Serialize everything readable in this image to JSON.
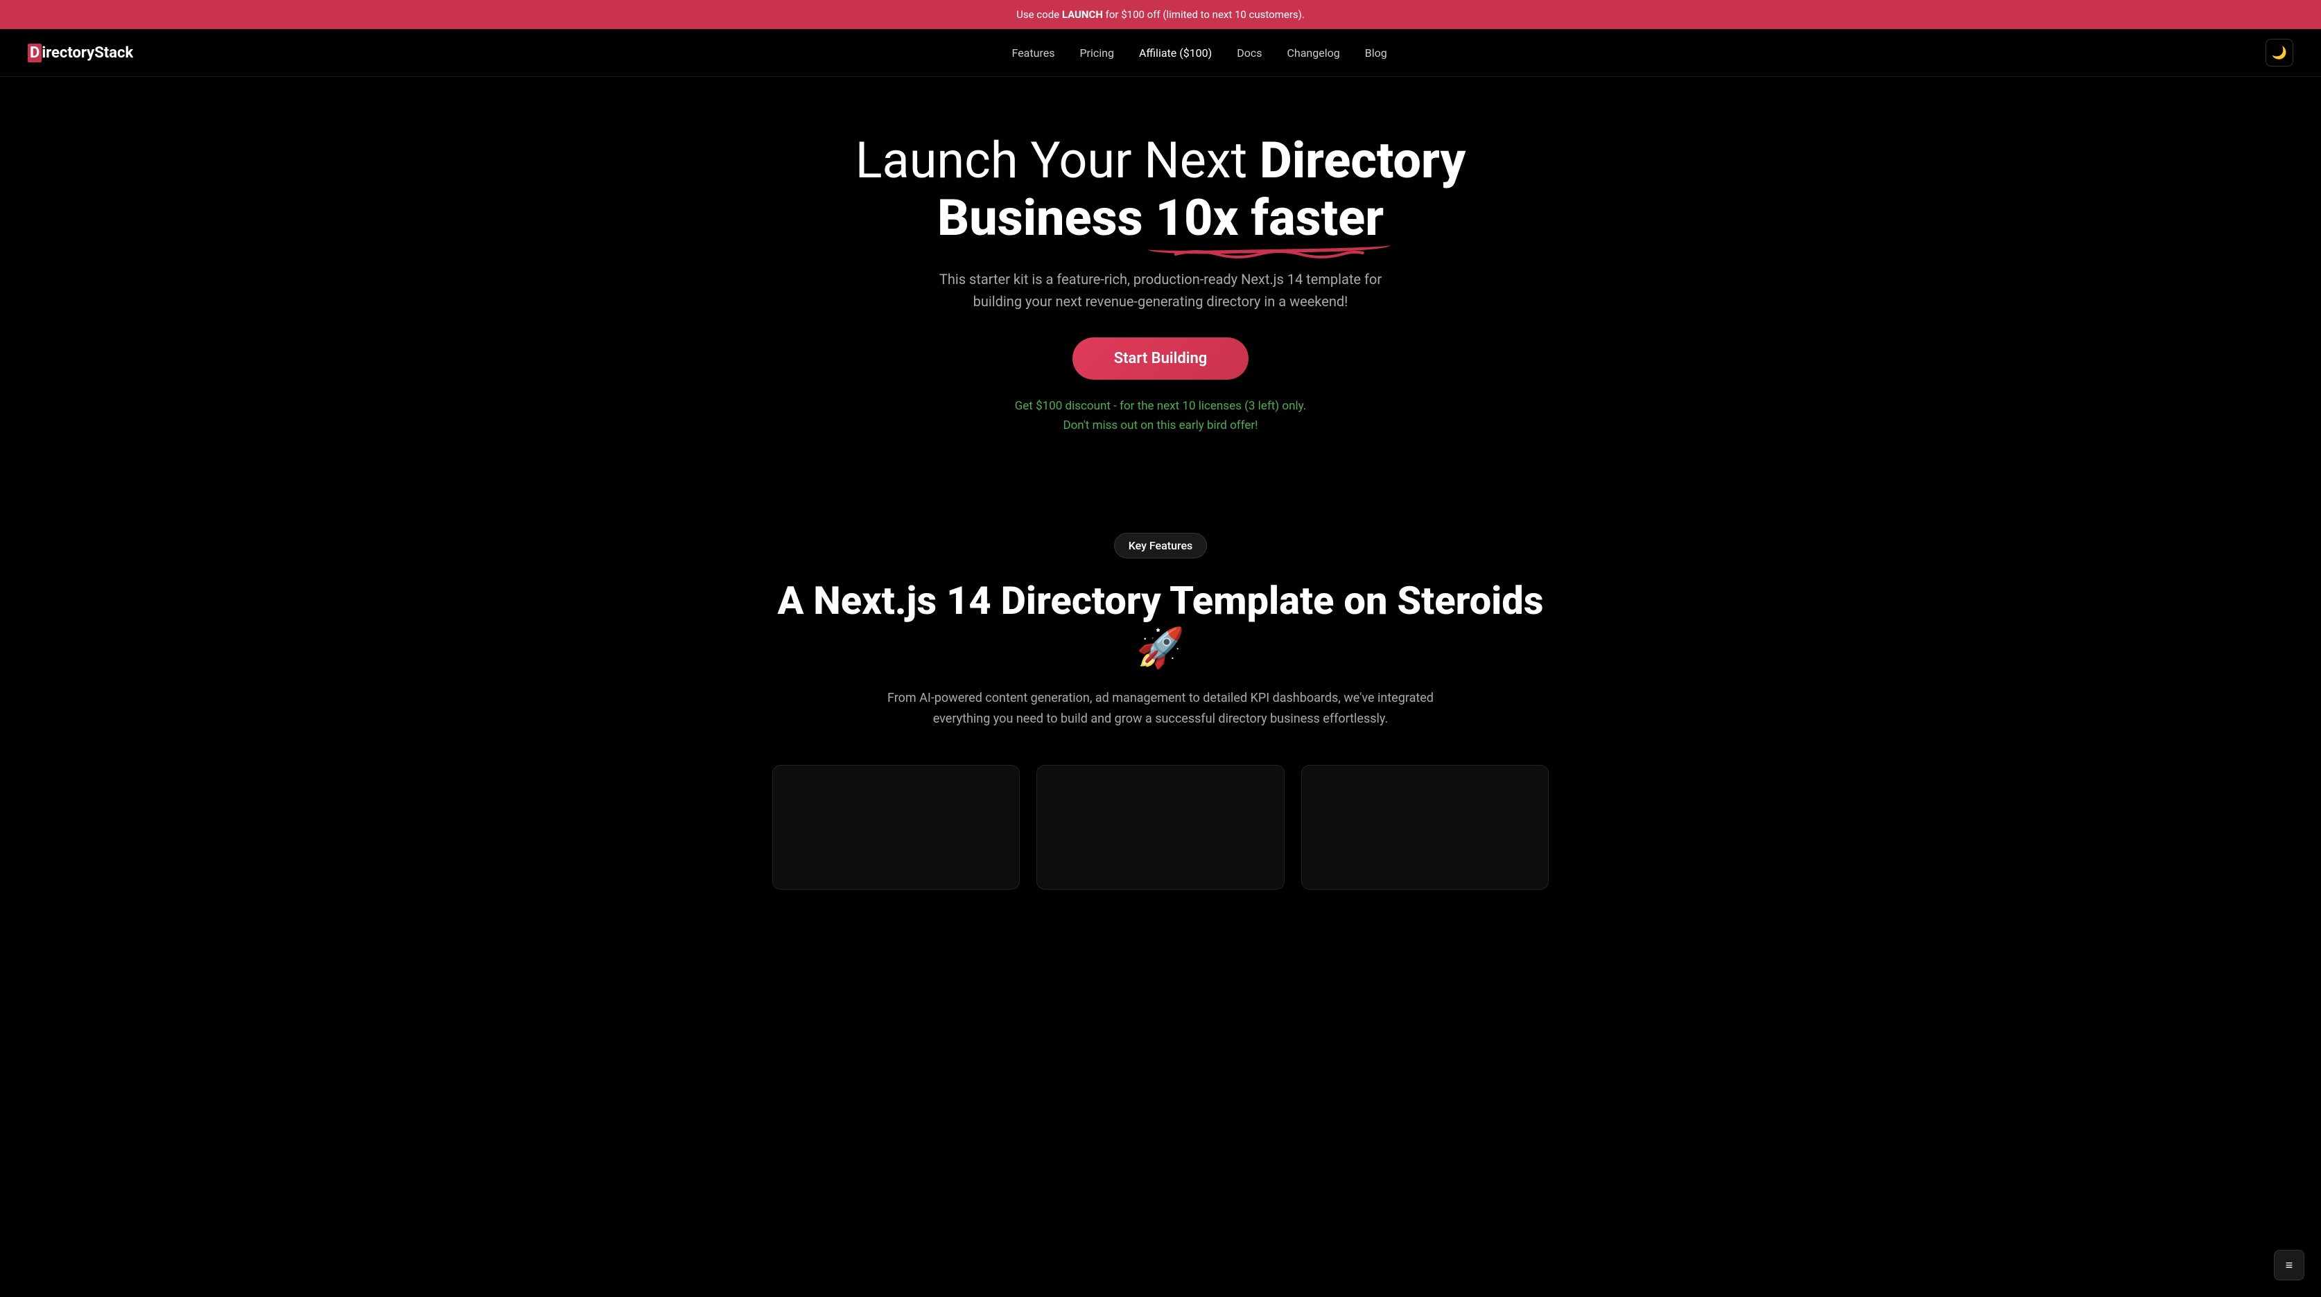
{
  "announcement": {
    "prefix": "Use code ",
    "code": "LAUNCH",
    "suffix": " for $100 off (limited to next 10 customers)."
  },
  "navbar": {
    "logo_text": "DirectoryStack",
    "links": [
      {
        "label": "Features",
        "href": "#features"
      },
      {
        "label": "Pricing",
        "href": "#pricing"
      },
      {
        "label": "Affiliate ($100)",
        "href": "#affiliate"
      },
      {
        "label": "Docs",
        "href": "#docs"
      },
      {
        "label": "Changelog",
        "href": "#changelog"
      },
      {
        "label": "Blog",
        "href": "#blog"
      }
    ],
    "theme_toggle_icon": "🌙"
  },
  "hero": {
    "title_part1": "Launch Your Next ",
    "title_bold": "Directory",
    "title_part2": "Business ",
    "title_underline": "10x faster",
    "subtitle": "This starter kit is a feature-rich, production-ready Next.js 14 template for building your next revenue-generating directory in a weekend!",
    "cta_label": "Start Building",
    "discount_line1": "Get $100 discount - for the next 10 licenses (3 left) only.",
    "discount_line2": "Don't miss out on this early bird offer!"
  },
  "features_section": {
    "badge": "Key Features",
    "title": "A Next.js 14 Directory Template on Steroids 🚀",
    "subtitle": "From AI-powered content generation, ad management to detailed KPI dashboards, we've integrated everything you need to build and grow a successful directory business effortlessly.",
    "cards": [
      {
        "title": "",
        "description": ""
      },
      {
        "title": "",
        "description": ""
      },
      {
        "title": "",
        "description": ""
      }
    ]
  },
  "scroll_button_icon": "≡",
  "colors": {
    "accent": "#c9334d",
    "green": "#4caf50",
    "background": "#000000",
    "card_bg": "#0d0d0d"
  }
}
